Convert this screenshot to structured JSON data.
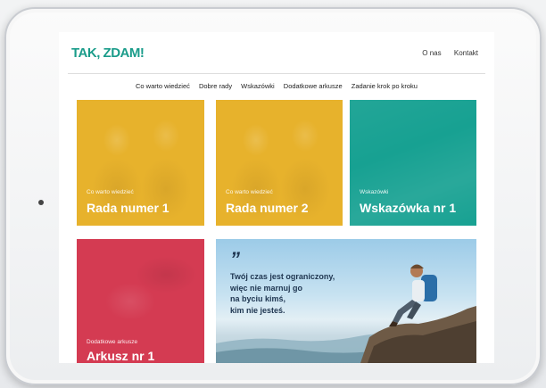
{
  "site": {
    "logo": "TAK, ZDAM!",
    "top_nav": [
      "O nas",
      "Kontakt"
    ]
  },
  "menu": [
    "Co warto wiedzieć",
    "Dobre rady",
    "Wskazówki",
    "Dodatkowe arkusze",
    "Zadanie krok po kroku"
  ],
  "tiles": [
    {
      "category": "Co warto wiedzieć",
      "title": "Rada numer 1",
      "color": "#e7b22c"
    },
    {
      "category": "Co warto wiedzieć",
      "title": "Rada numer 2",
      "color": "#e7b22c"
    },
    {
      "category": "Wskazówki",
      "title": "Wskazówka nr 1",
      "color": "#17a192"
    },
    {
      "category": "Dodatkowe arkusze",
      "title": "Arkusz nr 1",
      "color": "#d43b52"
    }
  ],
  "quote": {
    "mark": "”",
    "lines": [
      "Twój czas jest ograniczony,",
      "więc nie marnuj go",
      "na byciu kimś,",
      "kim nie jesteś."
    ]
  },
  "colors": {
    "accent": "#1a9c8a",
    "yellow": "#e7b22c",
    "teal": "#17a192",
    "red": "#d43b52",
    "quote_text": "#1e3550"
  }
}
